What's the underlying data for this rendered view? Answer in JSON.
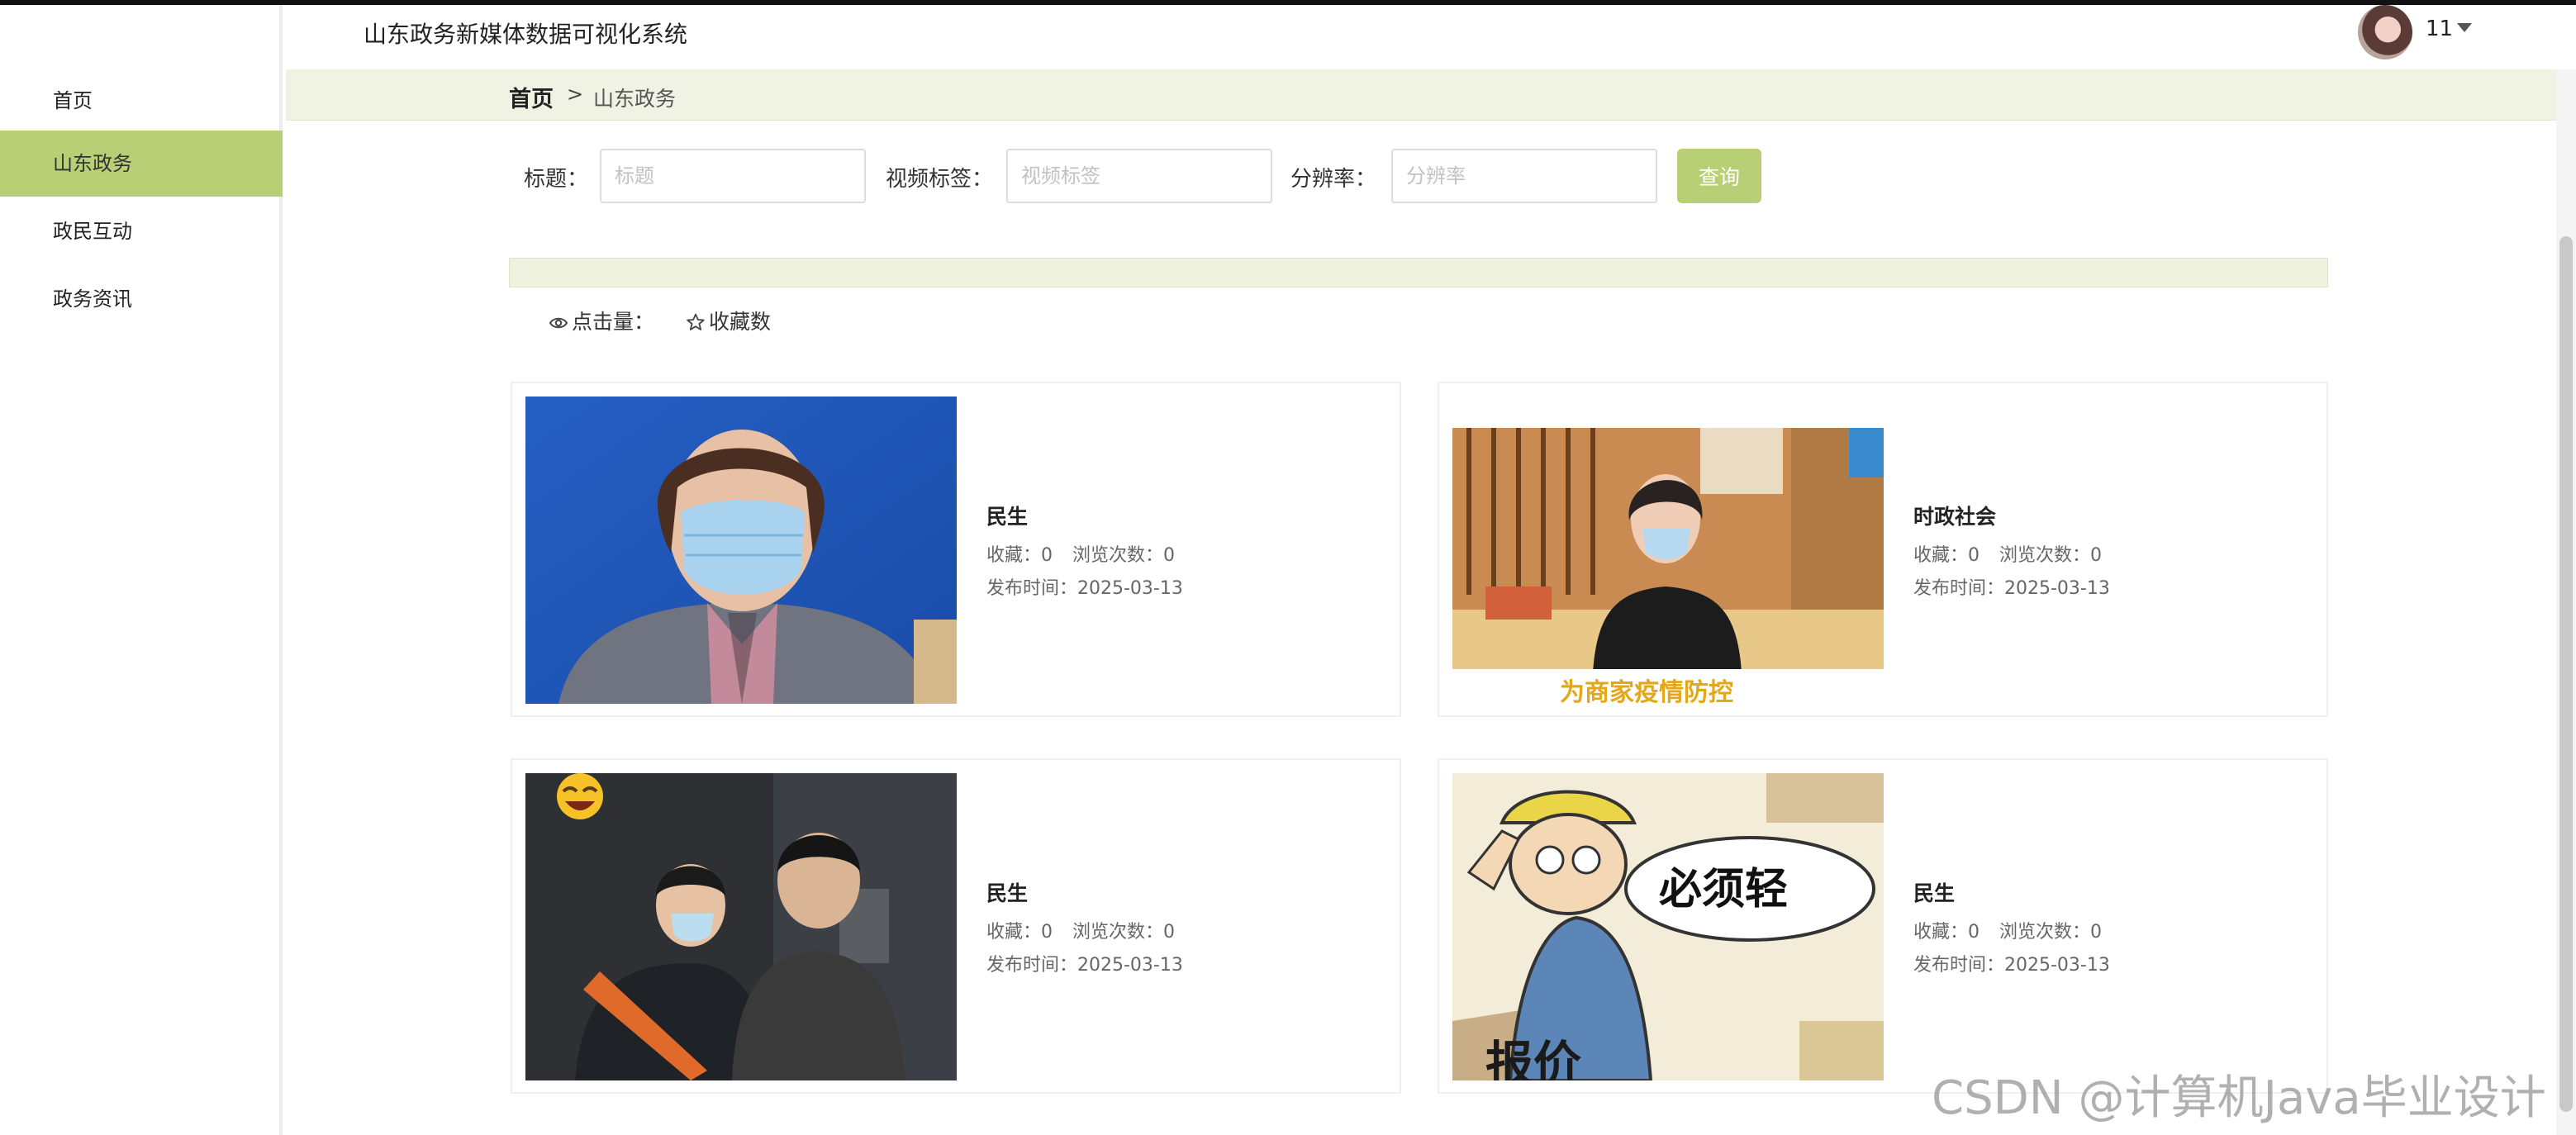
{
  "app": {
    "title": "山东政务新媒体数据可视化系统",
    "username": "11"
  },
  "sidebar": {
    "items": [
      {
        "label": "首页",
        "active": false
      },
      {
        "label": "山东政务",
        "active": true
      },
      {
        "label": "政民互动",
        "active": false
      },
      {
        "label": "政务资讯",
        "active": false
      }
    ]
  },
  "breadcrumb": {
    "home": "首页",
    "separator": ">",
    "current": "山东政务"
  },
  "search": {
    "title_label": "标题：",
    "title_placeholder": "标题",
    "tag_label": "视频标签：",
    "tag_placeholder": "视频标签",
    "resolution_label": "分辨率：",
    "resolution_placeholder": "分辨率",
    "button": "查询"
  },
  "sort": {
    "clicks_label": "点击量：",
    "favorites_label": "收藏数"
  },
  "cards": [
    {
      "title": "民生",
      "favorites": "收藏：0",
      "views": "浏览次数：0",
      "date": "发布时间：2025-03-13",
      "image": "masked-official-press-conference"
    },
    {
      "title": "时政社会",
      "favorites": "收藏：0",
      "views": "浏览次数：0",
      "date": "发布时间：2025-03-13",
      "image": "masked-presenter-studio"
    },
    {
      "title": "民生",
      "favorites": "收藏：0",
      "views": "浏览次数：0",
      "date": "发布时间：2025-03-13",
      "image": "award-sash-ceremony"
    },
    {
      "title": "民生",
      "favorites": "收藏：0",
      "views": "浏览次数：0",
      "date": "发布时间：2025-03-13",
      "image": "cartoon-worker-boxes"
    }
  ],
  "thumb_text": {
    "card2_caption": "为商家疫情防控",
    "card4_bubble": "必须轻",
    "card4_bottom": "报价"
  },
  "watermark": "CSDN @计算机Java毕业设计",
  "colors": {
    "accent": "#b9cf75",
    "crumb_bg": "#f0f3e3"
  }
}
